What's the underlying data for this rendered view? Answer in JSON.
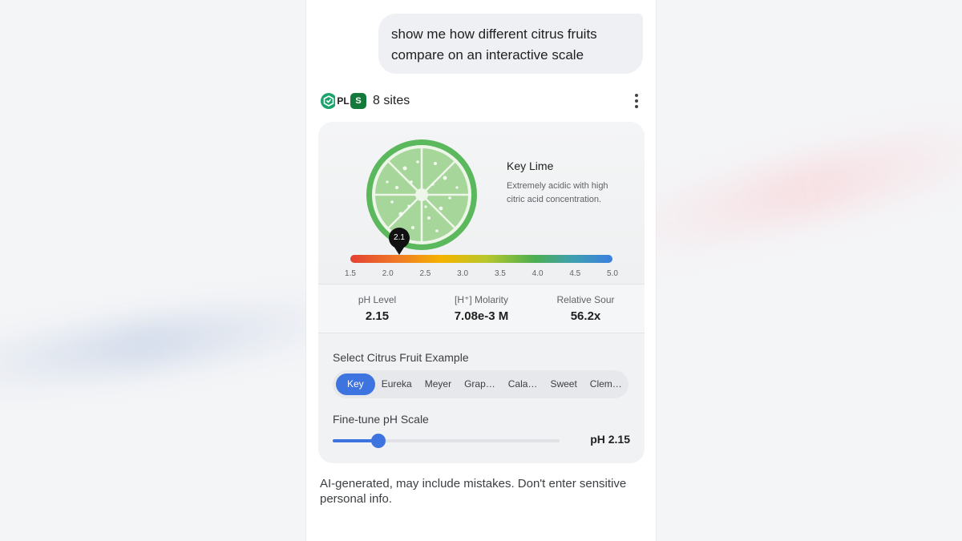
{
  "conversation": {
    "user_message": "show me how different citrus fruits compare on an interactive scale"
  },
  "sources": {
    "label": "8 sites",
    "icons": [
      "brainly-icon",
      "pl-logo-icon",
      "study-icon"
    ],
    "icon_letters": [
      "",
      "PL",
      "S"
    ],
    "more_menu_icon": "more-vert-icon"
  },
  "widget": {
    "fruit": {
      "name": "Key Lime",
      "description": "Extremely acidic with high citric acid concentration."
    },
    "ph_scale": {
      "marker_label": "2.1",
      "marker_value": 2.15,
      "min": 1.5,
      "max": 5.0,
      "ticks": [
        "1.5",
        "2.0",
        "2.5",
        "3.0",
        "3.5",
        "4.0",
        "4.5",
        "5.0"
      ]
    },
    "stats": [
      {
        "label": "pH Level",
        "value": "2.15"
      },
      {
        "label": "[H⁺] Molarity",
        "value": "7.08e-3 M"
      },
      {
        "label": "Relative Sour",
        "value": "56.2x"
      }
    ],
    "select_label": "Select Citrus Fruit Example",
    "fruit_options": [
      "Key",
      "Eureka",
      "Meyer",
      "Grap…",
      "Cala…",
      "Sweet",
      "Clem…"
    ],
    "selected_fruit": "Key",
    "finetune_label": "Fine-tune pH Scale",
    "slider_fraction": 0.2,
    "ph_readout": "pH 2.15"
  },
  "disclaimer": "AI-generated, may include mistakes. Don't enter sensitive personal info.",
  "colors": {
    "accent": "#3d74e0",
    "lime_rim": "#5cb85c",
    "lime_flesh": "#a7d69b"
  }
}
